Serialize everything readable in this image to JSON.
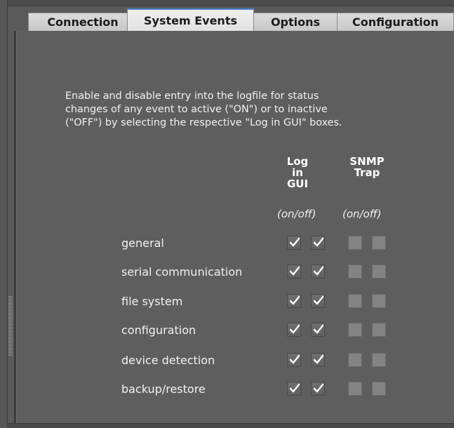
{
  "tabs": [
    {
      "label": "Connection",
      "active": false
    },
    {
      "label": "System Events",
      "active": true
    },
    {
      "label": "Options",
      "active": false
    },
    {
      "label": "Configuration",
      "active": false
    }
  ],
  "description": {
    "line1": "Enable and disable entry into the logfile for status",
    "line2": "changes of any event to active (\"ON\") or to inactive",
    "line3": "(\"OFF\") by selecting the respective \"Log in GUI\" boxes."
  },
  "columns": {
    "log": {
      "line1": "Log",
      "line2": "in",
      "line3": "GUI",
      "sub": "(on/off)"
    },
    "snmp": {
      "line1": "SNMP",
      "line2": "Trap",
      "sub": "(on/off)"
    }
  },
  "events": [
    {
      "label": "general",
      "log_on": true,
      "log_off": true,
      "snmp_on": false,
      "snmp_off": false
    },
    {
      "label": "serial communication",
      "log_on": true,
      "log_off": true,
      "snmp_on": false,
      "snmp_off": false
    },
    {
      "label": "file system",
      "log_on": true,
      "log_off": true,
      "snmp_on": false,
      "snmp_off": false
    },
    {
      "label": "configuration",
      "log_on": true,
      "log_off": true,
      "snmp_on": false,
      "snmp_off": false
    },
    {
      "label": "device detection",
      "log_on": true,
      "log_off": true,
      "snmp_on": false,
      "snmp_off": false
    },
    {
      "label": "backup/restore",
      "log_on": true,
      "log_off": true,
      "snmp_on": false,
      "snmp_off": false
    }
  ],
  "colors": {
    "background": "#5e5e5e",
    "tab_active_accent": "#4a7fd0",
    "text": "#f2f2f2"
  }
}
